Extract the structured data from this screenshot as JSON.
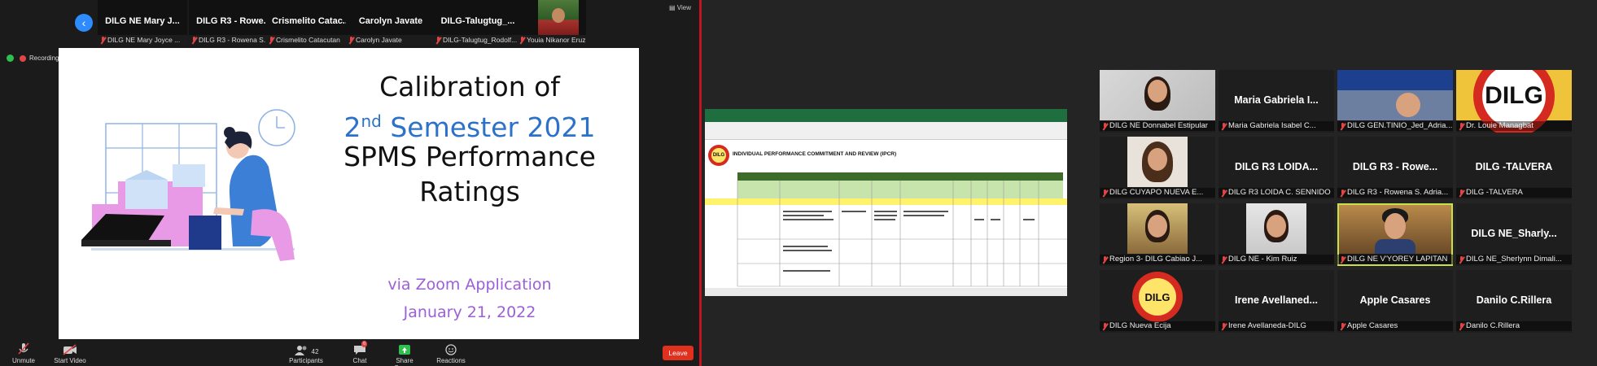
{
  "left": {
    "top_strip": [
      {
        "name": "DILG NE Mary J...",
        "label": "DILG NE Mary Joyce ..."
      },
      {
        "name": "DILG R3 - Rowe...",
        "label": "DILG R3 - Rowena S..."
      },
      {
        "name": "Crismelito  Catac...",
        "label": "Crismelito Catacutan"
      },
      {
        "name": "Carolyn Javate",
        "label": "Carolyn Javate"
      },
      {
        "name": "DILG-Talugtug_...",
        "label": "DILG-Talugtug_Rodolf..."
      },
      {
        "name": "",
        "label": "Youia Nikanor Eruz"
      }
    ],
    "view_label": "View",
    "recording_label": "Recording...",
    "slide": {
      "line1": "Calibration of",
      "line2_prefix": "2",
      "line2_sup": "nd",
      "line2_rest": " Semester 2021",
      "line3": "SPMS Performance",
      "line4": "Ratings",
      "sub1": "via Zoom Application",
      "sub2": "January 21, 2022"
    },
    "toolbar": {
      "unmute": "Unmute",
      "start_video": "Start Video",
      "participants": "Participants",
      "participants_count": "42",
      "chat": "Chat",
      "chat_badge": "6",
      "share_screen": "Share Screen",
      "reactions": "Reactions",
      "leave": "Leave"
    }
  },
  "right": {
    "grid": [
      {
        "name": "",
        "label": "DILG NE Donnabel Estipular",
        "video": "woman"
      },
      {
        "name": "Maria Gabriela I...",
        "label": "Maria Gabriela Isabel C..."
      },
      {
        "name": "",
        "label": "DILG GEN.TINIO_Jed_Adria...",
        "video": "man-banner"
      },
      {
        "name": "",
        "label": "Dr. Louie Managbat",
        "video": "dilg-big"
      },
      {
        "name": "",
        "label": "DILG CUYAPO NUEVA E...",
        "video": "woman2"
      },
      {
        "name": "DILG R3 LOIDA...",
        "label": "DILG R3 LOIDA C. SENNIDO"
      },
      {
        "name": "DILG R3 - Rowe...",
        "label": "DILG R3 - Rowena S. Adria..."
      },
      {
        "name": "DILG -TALVERA",
        "label": "DILG -TALVERA"
      },
      {
        "name": "",
        "label": "Region 3- DILG Cabiao J...",
        "video": "woman3"
      },
      {
        "name": "",
        "label": "DILG NE - Kim Ruiz",
        "video": "woman4"
      },
      {
        "name": "",
        "label": "DILG NE V'YOREY LAPITAN",
        "video": "man",
        "active": true
      },
      {
        "name": "DILG  NE_Sharly...",
        "label": "DILG NE_Sherlynn Dimali..."
      },
      {
        "name": "",
        "label": "DILG Nueva Ecija",
        "video": "dilg-logo"
      },
      {
        "name": "Irene  Avellaned...",
        "label": "Irene Avellaneda-DILG"
      },
      {
        "name": "Apple Casares",
        "label": "Apple Casares"
      },
      {
        "name": "Danilo C.Rillera",
        "label": "Danilo C.Rillera"
      }
    ],
    "shared_sheet_title": "INDIVIDUAL PERFORMANCE COMMITMENT AND REVIEW (IPCR)",
    "logo_text": "DILG"
  }
}
